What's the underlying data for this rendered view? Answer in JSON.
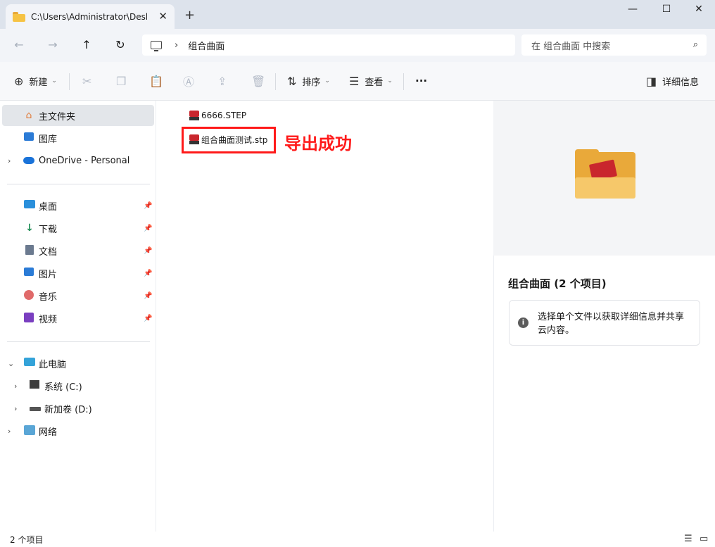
{
  "window": {
    "tab_title": "C:\\Users\\Administrator\\Desktop",
    "tab_close": "✕",
    "new_tab": "+",
    "minimize": "—",
    "maximize": "☐",
    "close": "✕"
  },
  "nav": {
    "back": "←",
    "forward": "→",
    "up": "↑",
    "refresh": "↻",
    "breadcrumb_chevron": "›",
    "breadcrumb": "组合曲面",
    "search_placeholder": "在 组合曲面 中搜索",
    "search_icon": "⌕"
  },
  "toolbar": {
    "new_label": "新建",
    "sort_label": "排序",
    "view_label": "查看",
    "more": "···",
    "details_label": "详细信息",
    "icons": {
      "new": "⊕",
      "cut": "✂",
      "copy": "❐",
      "paste": "📋",
      "rename": "Ⓐ",
      "share": "⇪",
      "delete": "🗑",
      "sort": "⇅",
      "view": "☰",
      "details": "◨"
    }
  },
  "sidebar": {
    "home": "主文件夹",
    "gallery": "图库",
    "onedrive": "OneDrive - Personal",
    "quick_access": [
      {
        "label": "桌面"
      },
      {
        "label": "下载"
      },
      {
        "label": "文档"
      },
      {
        "label": "图片"
      },
      {
        "label": "音乐"
      },
      {
        "label": "视频"
      }
    ],
    "this_pc": "此电脑",
    "drive_c": "系统 (C:)",
    "drive_d": "新加卷 (D:)",
    "network": "网络",
    "expand_closed": "›",
    "expand_open": "⌄",
    "pin": "📌"
  },
  "files": [
    {
      "name": "6666.STEP"
    },
    {
      "name": "组合曲面测试.stp"
    }
  ],
  "annotation": "导出成功",
  "details": {
    "title": "组合曲面 (2 个项目)",
    "info_icon": "i",
    "message": "选择单个文件以获取详细信息并共享云内容。"
  },
  "status": {
    "count": "2 个项目",
    "details_view": "☰",
    "tiles_view": "▭"
  },
  "colors": {
    "highlight": "#ff1a1a",
    "selection": "#e3e6ea",
    "accent": "#1a73d9"
  }
}
